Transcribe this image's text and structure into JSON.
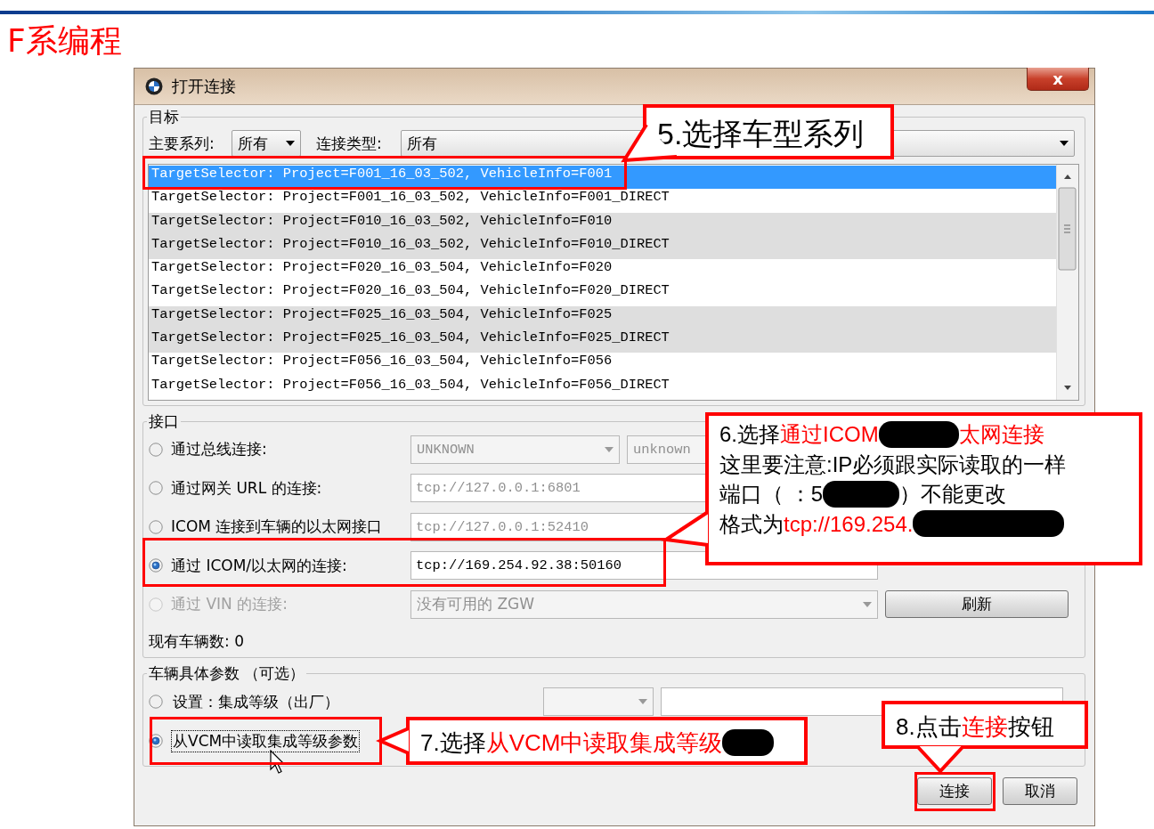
{
  "slide_title": "F系编程",
  "dialog": {
    "title": "打开连接",
    "close_label": "x",
    "target_group": {
      "legend": "目标",
      "series_label": "主要系列:",
      "series_value": "所有",
      "connection_type_label": "连接类型:",
      "connection_type_value": "所有",
      "targets": [
        {
          "text": "TargetSelector: Project=F001_16_03_502, VehicleInfo=F001",
          "selected": true,
          "shaded": false
        },
        {
          "text": "TargetSelector: Project=F001_16_03_502, VehicleInfo=F001_DIRECT",
          "selected": false,
          "shaded": false
        },
        {
          "text": "TargetSelector: Project=F010_16_03_502, VehicleInfo=F010",
          "selected": false,
          "shaded": true
        },
        {
          "text": "TargetSelector: Project=F010_16_03_502, VehicleInfo=F010_DIRECT",
          "selected": false,
          "shaded": true
        },
        {
          "text": "TargetSelector: Project=F020_16_03_504, VehicleInfo=F020",
          "selected": false,
          "shaded": false
        },
        {
          "text": "TargetSelector: Project=F020_16_03_504, VehicleInfo=F020_DIRECT",
          "selected": false,
          "shaded": false
        },
        {
          "text": "TargetSelector: Project=F025_16_03_504, VehicleInfo=F025",
          "selected": false,
          "shaded": true
        },
        {
          "text": "TargetSelector: Project=F025_16_03_504, VehicleInfo=F025_DIRECT",
          "selected": false,
          "shaded": true
        },
        {
          "text": "TargetSelector: Project=F056_16_03_504, VehicleInfo=F056",
          "selected": false,
          "shaded": false
        },
        {
          "text": "TargetSelector: Project=F056_16_03_504, VehicleInfo=F056_DIRECT",
          "selected": false,
          "shaded": false
        }
      ]
    },
    "interface_group": {
      "legend": "接口",
      "options": [
        {
          "kind": "combo-pair",
          "label": "通过总线连接:",
          "selected": false,
          "disabled": false,
          "values": [
            "UNKNOWN",
            "unknown"
          ]
        },
        {
          "kind": "field",
          "label": "通过网关 URL 的连接:",
          "selected": false,
          "disabled": false,
          "value": "tcp://127.0.0.1:6801"
        },
        {
          "kind": "field",
          "label": "ICOM 连接到车辆的以太网接口",
          "selected": false,
          "disabled": false,
          "value": "tcp://127.0.0.1:52410"
        },
        {
          "kind": "field",
          "label": "通过 ICOM/以太网的连接:",
          "selected": true,
          "disabled": false,
          "value": "tcp://169.254.92.38:50160"
        },
        {
          "kind": "combo-button",
          "label": "通过 VIN 的连接:",
          "selected": false,
          "disabled": true,
          "value": "没有可用的 ZGW",
          "button_label": "刷新"
        }
      ],
      "vehicle_count": "现有车辆数: 0"
    },
    "params_group": {
      "legend": "车辆具体参数 （可选）",
      "options": [
        {
          "kind": "combo-field",
          "label": "设置：集成等级（出厂）",
          "selected": false,
          "focused": false
        },
        {
          "kind": "plain",
          "label": "从VCM中读取集成等级参数",
          "selected": true,
          "focused": true
        }
      ]
    },
    "buttons": [
      {
        "label": "连接"
      },
      {
        "label": "取消"
      }
    ]
  },
  "callouts": [
    {
      "lines": [
        [
          {
            "kind": "plain",
            "text": "5.选择车型系列"
          }
        ]
      ]
    },
    {
      "lines": [
        [
          {
            "kind": "plain",
            "text": "6.选择"
          },
          {
            "kind": "emphasis",
            "text": "通过ICOM"
          },
          {
            "kind": "redacted"
          },
          {
            "kind": "emphasis",
            "text": "太网连接"
          }
        ],
        [
          {
            "kind": "plain",
            "text": "这里要注意:IP必须跟实际读取的一样"
          }
        ],
        [
          {
            "kind": "plain",
            "text": "端口（ ：5"
          },
          {
            "kind": "redacted"
          },
          {
            "kind": "plain",
            "text": "）不能更改"
          }
        ],
        [
          {
            "kind": "plain",
            "text": "格式为"
          },
          {
            "kind": "emphasis",
            "text": "tcp://169.254."
          },
          {
            "kind": "redacted"
          }
        ]
      ]
    },
    {
      "lines": [
        [
          {
            "kind": "plain",
            "text": "7.选择"
          },
          {
            "kind": "emphasis",
            "text": "从VCM中读取集成等级"
          },
          {
            "kind": "redacted"
          }
        ]
      ]
    },
    {
      "lines": [
        [
          {
            "kind": "plain",
            "text": "8.点击"
          },
          {
            "kind": "emphasis",
            "text": "连接"
          },
          {
            "kind": "plain",
            "text": "按钮"
          }
        ]
      ]
    }
  ]
}
